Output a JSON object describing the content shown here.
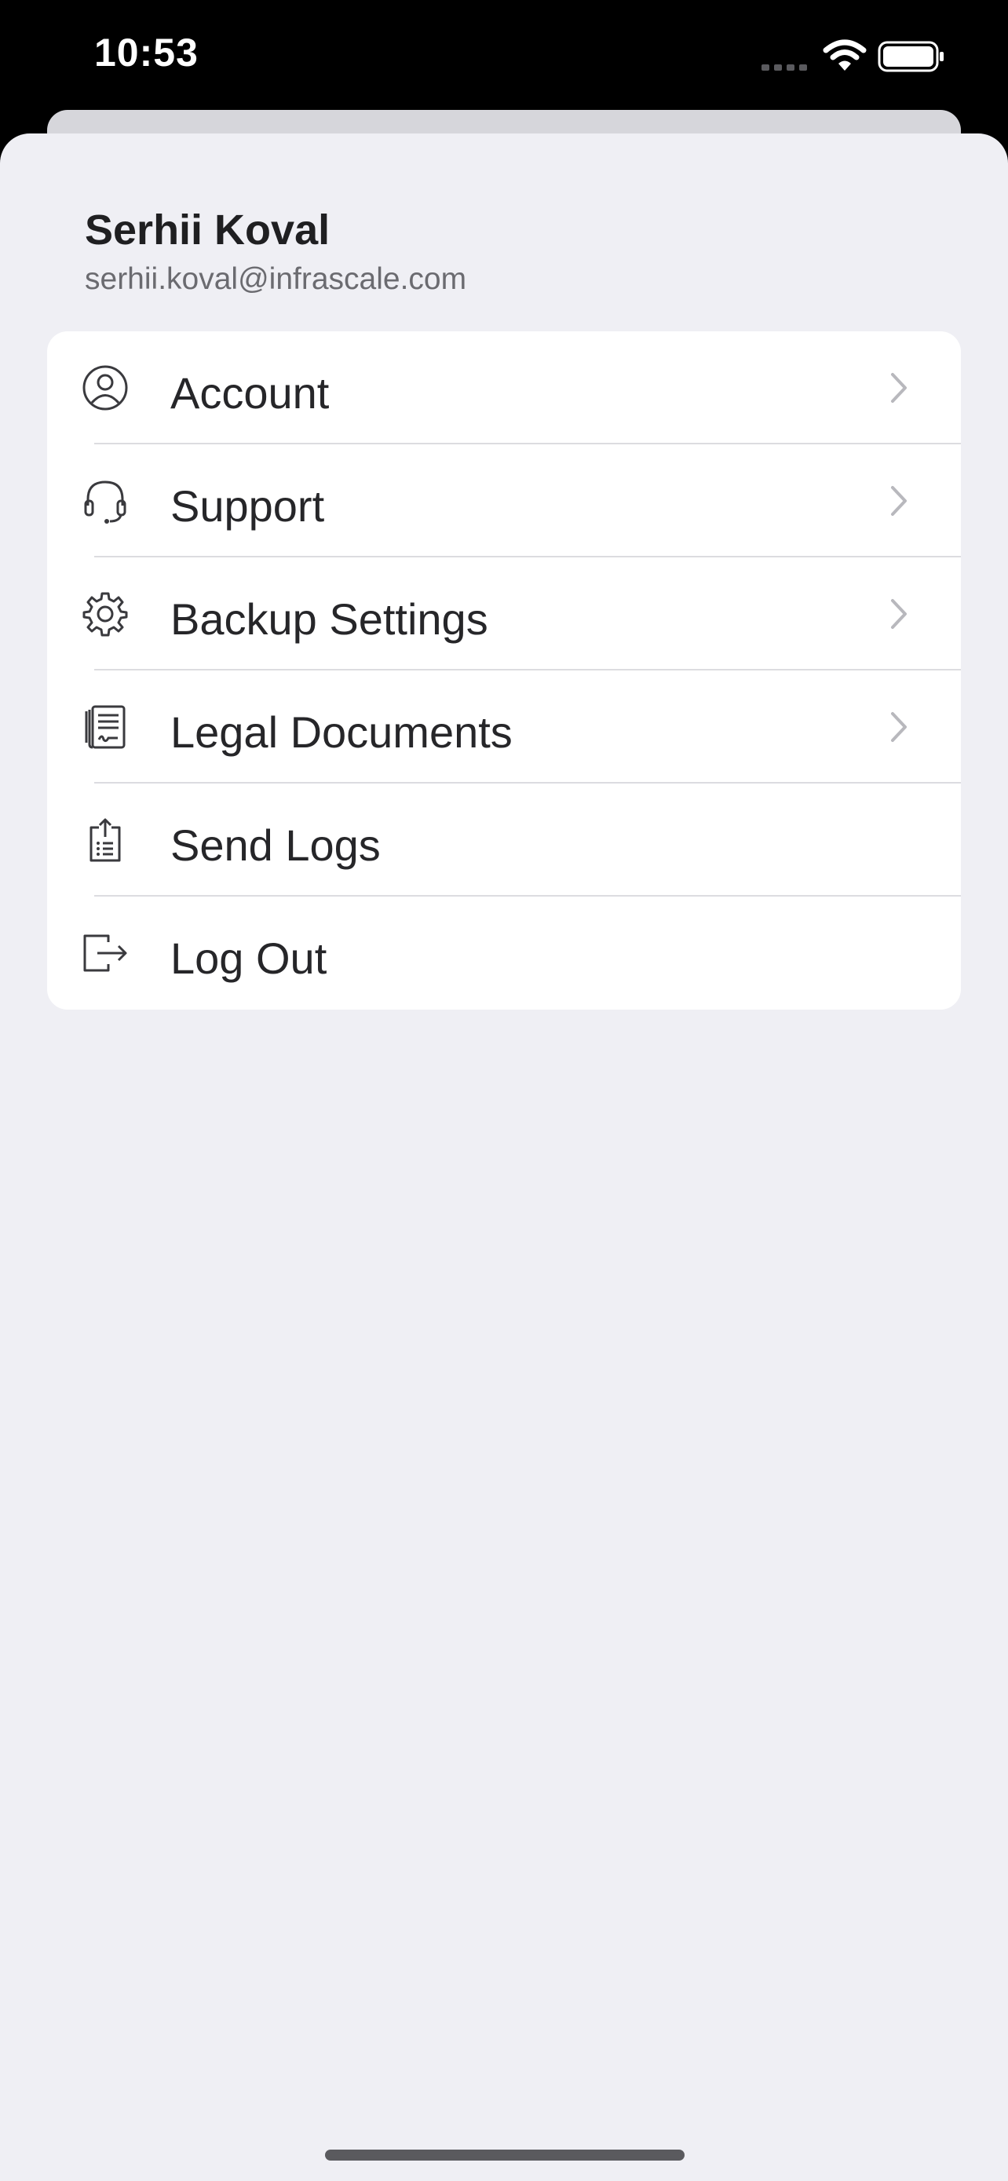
{
  "status_bar": {
    "time": "10:53",
    "icons": [
      "cellular-signal-icon",
      "wifi-icon",
      "battery-icon"
    ]
  },
  "profile": {
    "name": "Serhii Koval",
    "email": "serhii.koval@infrascale.com"
  },
  "menu": {
    "items": [
      {
        "label": "Account",
        "icon": "person-circle-icon",
        "has_chevron": true
      },
      {
        "label": "Support",
        "icon": "headset-icon",
        "has_chevron": true
      },
      {
        "label": "Backup Settings",
        "icon": "gear-icon",
        "has_chevron": true
      },
      {
        "label": "Legal Documents",
        "icon": "document-icon",
        "has_chevron": true
      },
      {
        "label": "Send Logs",
        "icon": "clipboard-upload-icon",
        "has_chevron": false
      },
      {
        "label": "Log Out",
        "icon": "logout-icon",
        "has_chevron": false
      }
    ]
  },
  "colors": {
    "sheet_background": "#efeff4",
    "card_background": "#ffffff",
    "text_primary": "#262629",
    "text_secondary": "#6b6b70",
    "chevron": "#b8b8bd",
    "icon": "#3a3a3e"
  }
}
